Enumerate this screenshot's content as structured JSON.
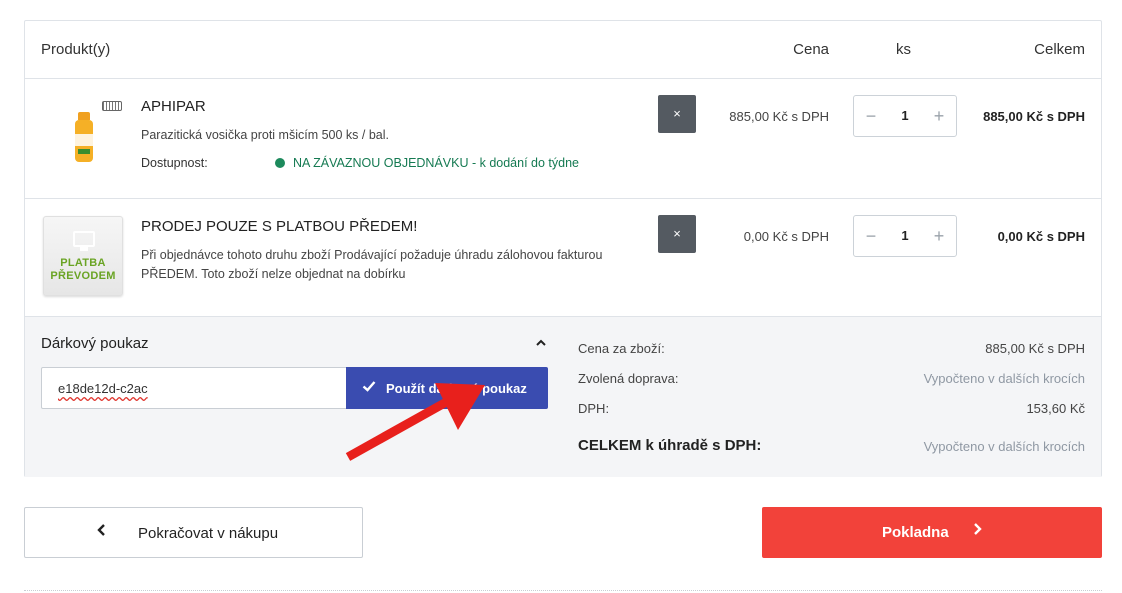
{
  "cart": {
    "headers": {
      "product": "Produkt(y)",
      "price": "Cena",
      "qty": "ks",
      "total": "Celkem"
    },
    "items": [
      {
        "name": "APHIPAR",
        "description": "Parazitická vosička proti mšicím 500 ks / bal.",
        "availability_label": "Dostupnost:",
        "availability": "NA ZÁVAZNOU OBJEDNÁVKU - k dodání do týdne",
        "remove_label": "×",
        "unit_price": "885,00 Kč s DPH",
        "quantity": "1",
        "total": "885,00 Kč s DPH"
      },
      {
        "name": "PRODEJ POUZE S PLATBOU PŘEDEM!",
        "description_line1": "Při objednávce tohoto druhu zboží Prodávající požaduje úhradu zálohovou fakturou",
        "description_line2": "PŘEDEM. Toto zboží nelze objednat na dobírku",
        "thumb_line1": "PLATBA",
        "thumb_line2": "PŘEVODEM",
        "remove_label": "×",
        "unit_price": "0,00 Kč s DPH",
        "quantity": "1",
        "total": "0,00 Kč s DPH"
      }
    ],
    "stepper": {
      "minus": "−",
      "plus": "+"
    }
  },
  "gift": {
    "title": "Dárkový poukaz",
    "code": "e18de12d-c2ac",
    "button_label": "Použít dárkový poukaz"
  },
  "summary": {
    "goods_label": "Cena za zboží:",
    "goods_value": "885,00 Kč s DPH",
    "shipping_label": "Zvolená doprava:",
    "shipping_value": "Vypočteno v dalších krocích",
    "vat_label": "DPH:",
    "vat_value": "153,60 Kč",
    "total_label": "CELKEM k úhradě s DPH:",
    "total_value": "Vypočteno v dalších krocích"
  },
  "nav": {
    "continue_label": "Pokračovat v nákupu",
    "checkout_label": "Pokladna"
  },
  "colors": {
    "checkout_bg": "#f2423a",
    "apply_bg": "#3a4cb0",
    "availability": "#157a52",
    "arrow": "#e8201c"
  }
}
